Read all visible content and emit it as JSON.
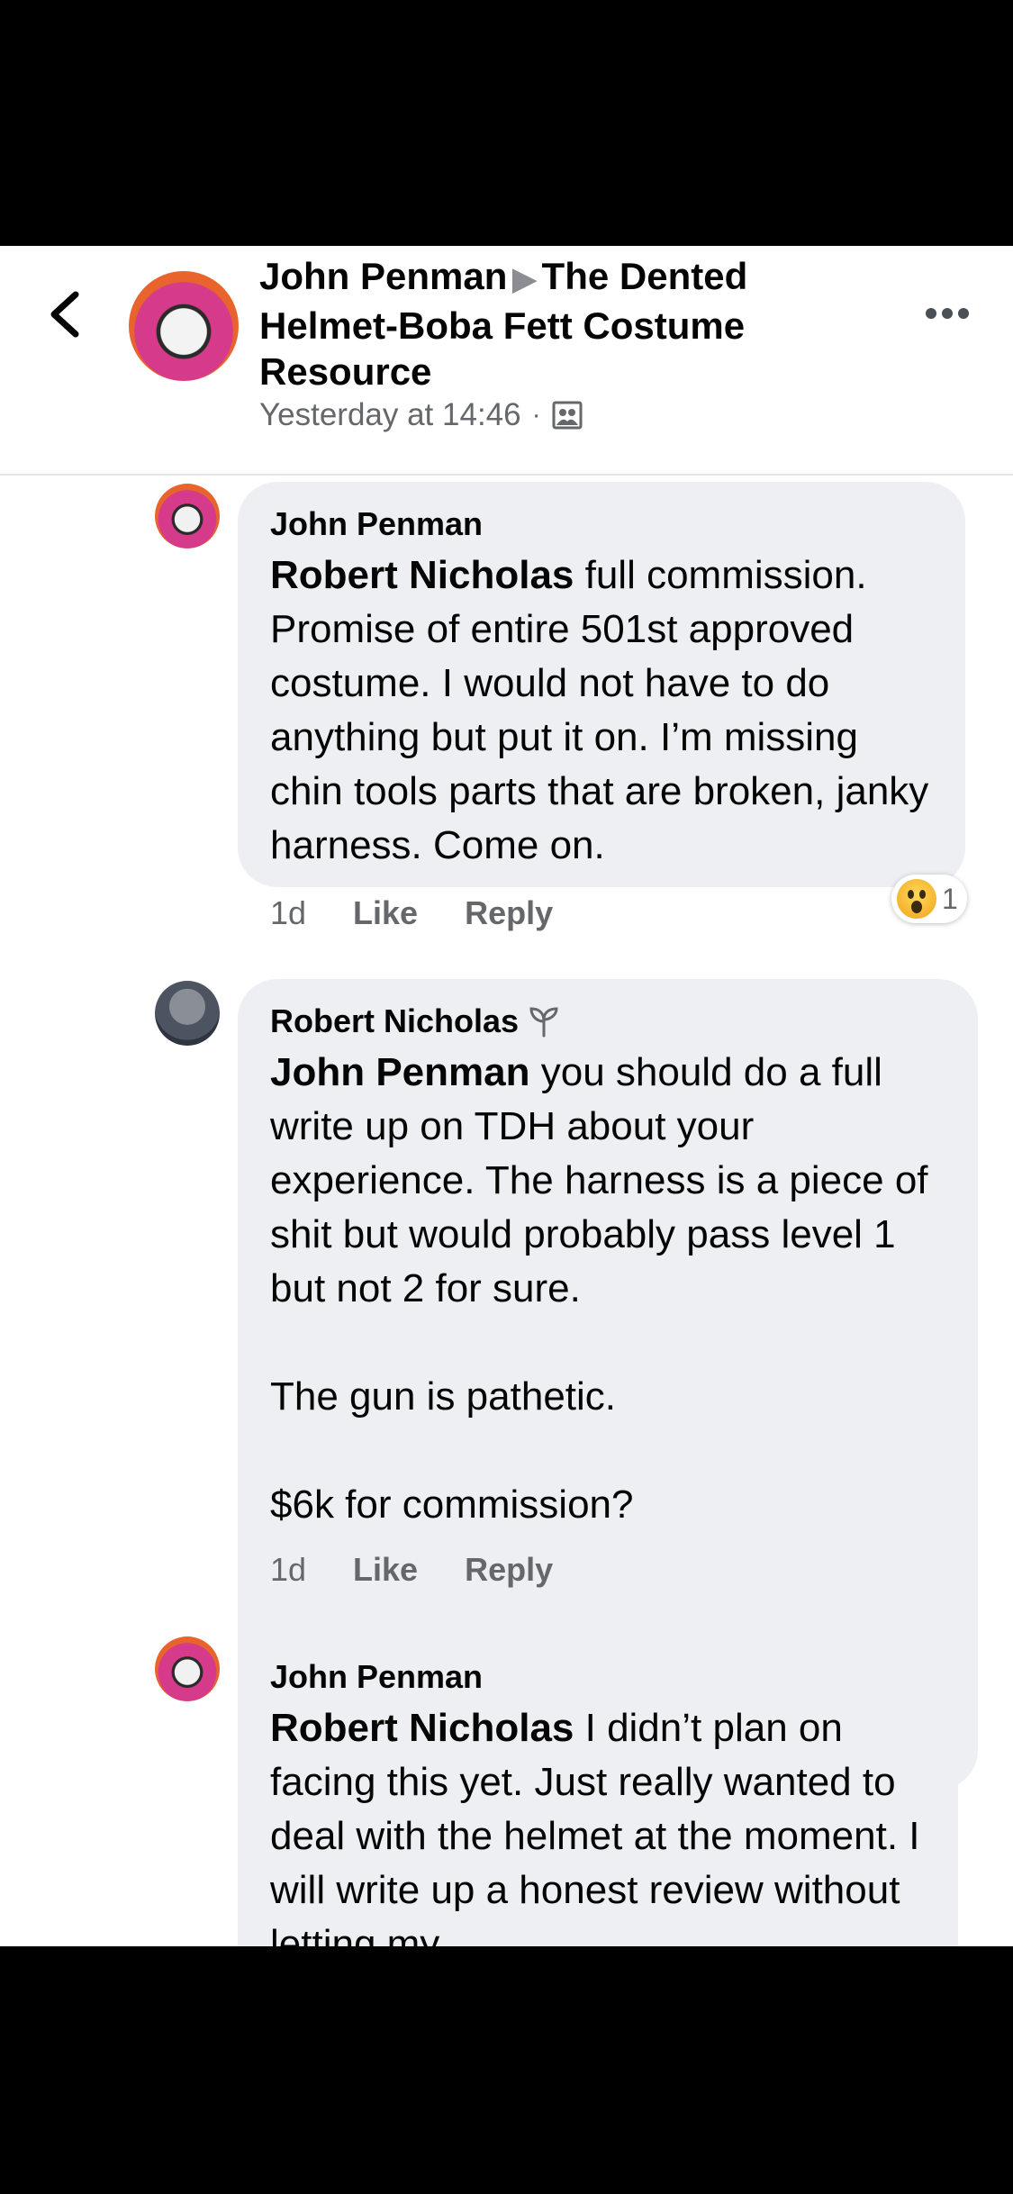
{
  "header": {
    "author": "John Penman",
    "group": "The Dented Helmet-Boba Fett Costume Resource",
    "timestamp": "Yesterday at 14:46",
    "separator": "·",
    "icons": {
      "back": "chevron-left-icon",
      "privacy": "group-privacy-icon",
      "more": "more-options-icon"
    }
  },
  "comments": [
    {
      "author": "John Penman",
      "mention": "Robert Nicholas",
      "text": " full commission. Promise of entire  501st approved costume. I would not have to do anything but put it on. I’m missing chin tools parts that are broken, janky harness. Come on.",
      "time": "1d",
      "like": "Like",
      "reply": "Reply",
      "reaction": {
        "icon": "wow-reaction-icon",
        "count": "1"
      }
    },
    {
      "author": "Robert Nicholas",
      "author_badge": "new-member-sprout-icon",
      "mention": "John Penman",
      "text": " you should do a full write up on TDH about your experience. The harness is a piece of shit but would probably pass level 1 but not 2 for sure.\n\nThe gun is pathetic.\n\n$6k for commission?",
      "time": "1d",
      "like": "Like",
      "reply": "Reply"
    },
    {
      "author": "John Penman",
      "mention": "Robert Nicholas",
      "text": " I didn’t plan on facing this yet. Just really wanted to deal with the helmet at the moment. I will write up a honest review without letting my"
    }
  ]
}
